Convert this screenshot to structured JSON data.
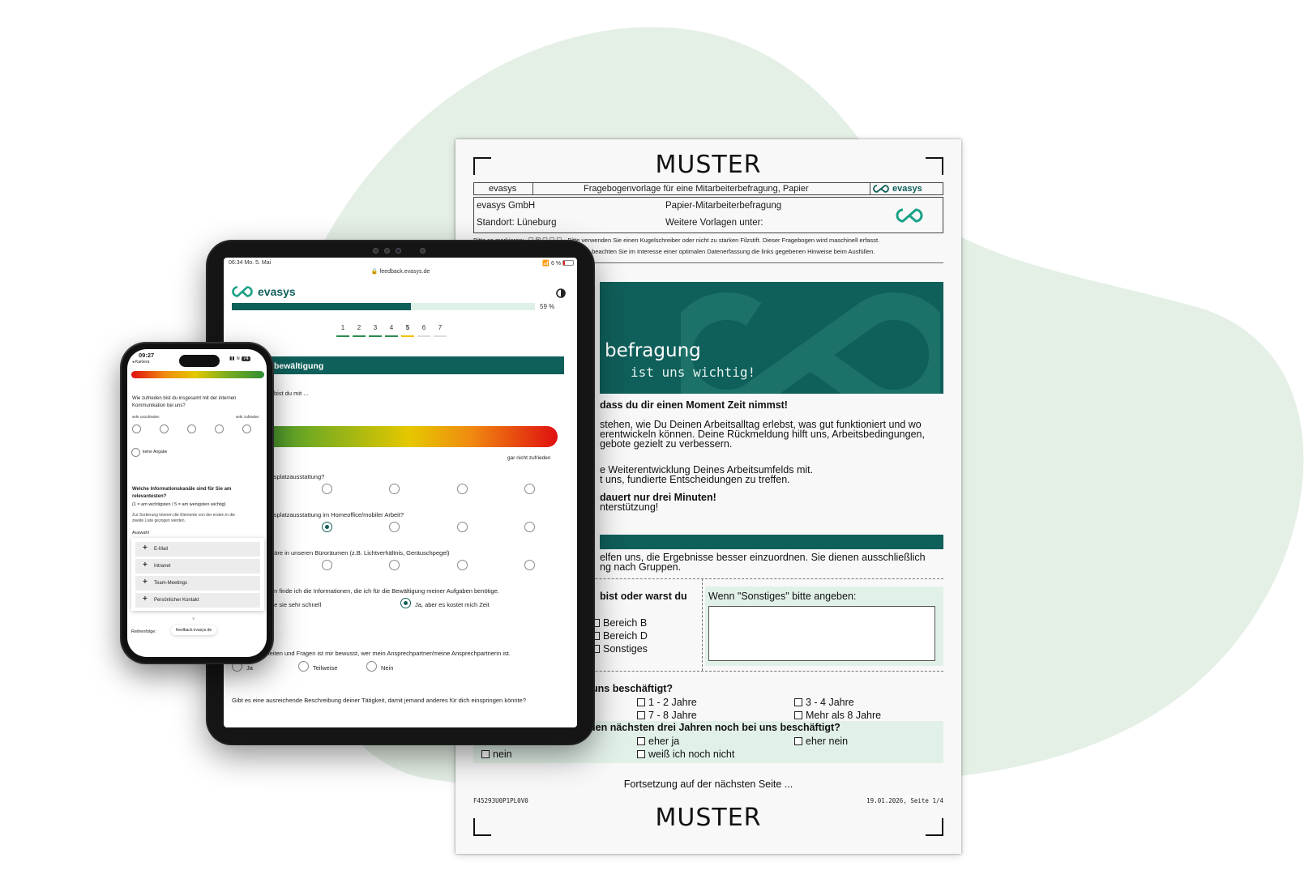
{
  "theme": {
    "brand_teal": "#0f5f5a",
    "blob": "#e4efe5",
    "light_green": "#e2f1e8"
  },
  "paper": {
    "watermark_top": "MUSTER",
    "watermark_bottom": "MUSTER",
    "header": {
      "left": "evasys",
      "center": "Fragebogenvorlage für eine Mitarbeiterbefragung, Papier",
      "brand": "evasys"
    },
    "info": {
      "company": "evasys GmbH",
      "location": "Standort: Lüneburg",
      "type": "Papier-Mitarbeiterbefragung",
      "more": "Weitere Vorlagen unter:"
    },
    "hint1_label": "Bitte so markieren:",
    "hint1_text": "Bitte verwenden Sie einen Kugelschreiber oder nicht zu starken Filzstift. Dieser Fragebogen wird maschinell erfasst.",
    "hint2_text": "itte beachten Sie im Interesse einer optimalen Datenerfassung die links gegebenen Hinweise beim Ausfüllen.",
    "banner_title": "befragung",
    "banner_sub": "ist uns wichtig!",
    "intro_bold": "dass du dir einen Moment Zeit nimmst!",
    "para1": [
      "stehen, wie Du Deinen Arbeitsalltag erlebst, was gut funktioniert und wo",
      "erentwickeln können. Deine Rückmeldung hilft uns, Arbeitsbedingungen,",
      "gebote gezielt zu verbessern."
    ],
    "para2": [
      "e Weiterentwicklung Deines Arbeitsumfelds mit.",
      "t uns, fundierte Entscheidungen zu treffen."
    ],
    "para3_bold": "dauert nur drei Minuten!",
    "para3": "nterstützung!",
    "section_text": [
      "elfen uns, die Ergebnisse besser einzuordnen. Sie dienen ausschließlich",
      "ng nach Gruppen."
    ],
    "q1": "bist oder warst du",
    "q1_options": [
      "Bereich B",
      "Bereich D",
      "Sonstiges"
    ],
    "other_label": "Wenn \"Sonstiges\" bitte angeben:",
    "q2": "uns beschäftigt?",
    "q2_options": [
      "1 - 2 Jahre",
      "3 - 4 Jahre",
      "7 - 8 Jahre",
      "Mehr als 8 Jahre"
    ],
    "q3": "den nächsten drei Jahren noch bei uns beschäftigt?",
    "q3_options": [
      "eher ja",
      "eher nein",
      "nein",
      "weiß ich noch nicht"
    ],
    "continue": "Fortsetzung auf der nächsten Seite ...",
    "form_id": "F45293U0P1PL0V0",
    "date_page": "19.01.2026, Seite 1/4"
  },
  "tablet": {
    "time": "06:34  Mo. 5. Mai",
    "battery": "6 %",
    "url": "feedback.evasys.de",
    "brand": "evasys",
    "progress_pct": 59,
    "progress_label": "59 %",
    "steps": [
      "1",
      "2",
      "3",
      "4",
      "5",
      "6",
      "7"
    ],
    "active_step": "5",
    "section_title": "bewältigung",
    "q_intro": "bist du mit ...",
    "scale_right": "gar nicht zufrieden",
    "scale_left": "n",
    "q1": "itsplatzausstattung?",
    "q2": "itsplatzausstattung im Homeoffice/mobiler Arbeit?",
    "q3": "häre in unseren Büroräumen (z.B. Lichtverhältnis, Geräuschpegel)",
    "q4": "en finde ich die Informationen, die ich für die Bewältigung meiner Aufgaben benötige.",
    "q4_opt1": "de sie sehr schnell",
    "q4_opt2": "Ja, aber es kostet mich Zeit",
    "q4_opt3": "l",
    "q5": "Bei Unsicherheiten und Fragen ist mir bewusst, wer mein Ansprechpartner/meine Ansprechpartnerin ist.",
    "q5_opts": [
      "Ja",
      "Teilweise",
      "Nein"
    ],
    "q6": "Gibt es eine ausreichende Beschreibung deiner Tätigkeit, damit jemand anderes für dich einspringen könnte?"
  },
  "phone": {
    "time": "09:27",
    "back": "◂ Kamera",
    "battery": "74",
    "q1": [
      "Wie zufrieden bist du insgesamt mit der internen",
      "Kommunikation bei uns?"
    ],
    "scale_left": "sehr unzufrieden",
    "scale_right": "sehr zufrieden",
    "no_answer": "keine Angabe",
    "q2": [
      "Welche Informationskanäle sind für Sie am",
      "relevantesten?"
    ],
    "q2_hint": "(1 = am wichtigsten / 5 = am wenigsten wichtig)",
    "q2_help": [
      "Zur Sortierung können die Elemente von der ersten in die",
      "zweite Liste gezogen werden."
    ],
    "selection_label": "Auswahl",
    "items": [
      "E-Mail",
      "Intranet",
      "Team-Meetings",
      "Persönlicher Kontakt"
    ],
    "order_label": "Reihenfolge:",
    "url": "feedback.evasys.de"
  }
}
